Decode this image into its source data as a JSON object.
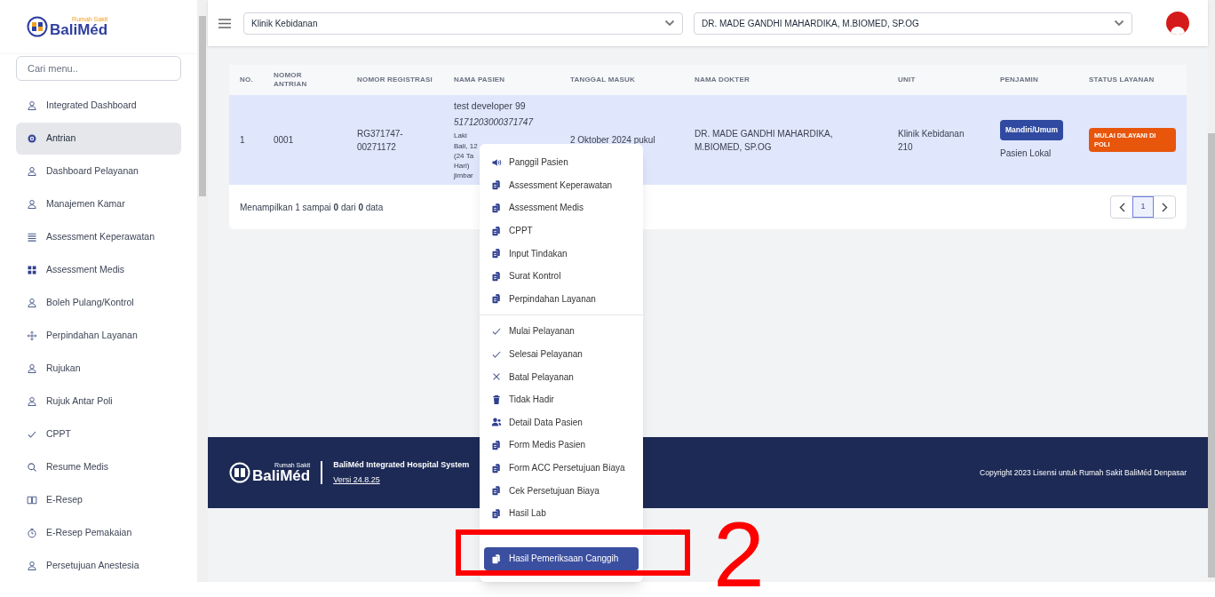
{
  "sidebar": {
    "logo": {
      "top": "Rumah Sakit",
      "name": "BaliMéd"
    },
    "search": {
      "placeholder": "Cari menu.."
    },
    "items": [
      {
        "label": "Integrated Dashboard",
        "kind": "user",
        "selected": false
      },
      {
        "label": "Antrian",
        "kind": "at",
        "selected": true
      },
      {
        "label": "Dashboard Pelayanan",
        "kind": "user",
        "selected": false
      },
      {
        "label": "Manajemen Kamar",
        "kind": "user",
        "selected": false
      },
      {
        "label": "Assessment Keperawatan",
        "kind": "list",
        "selected": false
      },
      {
        "label": "Assessment Medis",
        "kind": "grid",
        "selected": false
      },
      {
        "label": "Boleh Pulang/Kontrol",
        "kind": "user",
        "selected": false
      },
      {
        "label": "Perpindahan Layanan",
        "kind": "move",
        "selected": false
      },
      {
        "label": "Rujukan",
        "kind": "user",
        "selected": false
      },
      {
        "label": "Rujuk Antar Poli",
        "kind": "user",
        "selected": false
      },
      {
        "label": "CPPT",
        "kind": "check",
        "selected": false
      },
      {
        "label": "Resume Medis",
        "kind": "search",
        "selected": false
      },
      {
        "label": "E-Resep",
        "kind": "book",
        "selected": false
      },
      {
        "label": "E-Resep Pemakaian",
        "kind": "clock",
        "selected": false
      },
      {
        "label": "Persetujuan Anestesia",
        "kind": "user",
        "selected": false
      }
    ]
  },
  "header": {
    "clinic_select": "Klinik Kebidanan",
    "doctor_select": "DR. MADE GANDHI MAHARDIKA, M.BIOMED, SP.OG"
  },
  "table": {
    "columns": [
      "NO.",
      "NOMOR ANTRIAN",
      "NOMOR REGISTRASI",
      "NAMA PASIEN",
      "TANGGAL MASUK",
      "NAMA DOKTER",
      "UNIT",
      "PENJAMIN",
      "STATUS LAYANAN"
    ],
    "rows": [
      {
        "selected": true,
        "no": "1",
        "antrian": "0001",
        "registrasi": "RG371747-00271172",
        "nama": "test developer 99",
        "nik": "5171203000371747",
        "details": [
          "Laki",
          "Bali, 12",
          "(24 Ta",
          "Hari)",
          "jimbar"
        ],
        "tanggal": "2 Oktober 2024 pukul",
        "dokter": "DR. MADE GANDHI MAHARDIKA, M.BIOMED, SP.OG",
        "unit": "Klinik Kebidanan 210",
        "penjamin": "Mandiri/Umum",
        "penjamin_note": "Pasien Lokal",
        "status": "MULAI DILAYANI DI POLI"
      }
    ],
    "summary": "Menampilkan 1 sampai **0** dari **0** data",
    "pages": [
      {
        "label": "1",
        "selected": true
      }
    ]
  },
  "context_menu": [
    {
      "label": "Panggil Pasien",
      "kind": "speaker",
      "selected": false
    },
    {
      "label": "Assessment Keperawatan",
      "kind": "doc",
      "selected": false
    },
    {
      "label": "Assessment Medis",
      "kind": "doc",
      "selected": false
    },
    {
      "label": "CPPT",
      "kind": "doc",
      "selected": false
    },
    {
      "label": "Input Tindakan",
      "kind": "doc",
      "selected": false
    },
    {
      "label": "Surat Kontrol",
      "kind": "doc",
      "selected": false
    },
    {
      "label": "Perpindahan Layanan",
      "kind": "doc",
      "selected": false
    },
    {
      "kind": "separator"
    },
    {
      "label": "Mulai Pelayanan",
      "kind": "check",
      "selected": false
    },
    {
      "label": "Selesai Pelayanan",
      "kind": "check",
      "selected": false
    },
    {
      "label": "Batal Pelayanan",
      "kind": "x",
      "selected": false
    },
    {
      "label": "Tidak Hadir",
      "kind": "trash",
      "selected": false
    },
    {
      "label": "Detail Data Pasien",
      "kind": "users",
      "selected": false
    },
    {
      "label": "Form Medis Pasien",
      "kind": "doc",
      "selected": false
    },
    {
      "label": "Form ACC Persetujuan Biaya",
      "kind": "doc",
      "selected": false
    },
    {
      "label": "Cek Persetujuan Biaya",
      "kind": "doc",
      "selected": false
    },
    {
      "label": "Hasil Lab",
      "kind": "doc",
      "selected": false
    },
    {
      "kind": "hidden"
    },
    {
      "label": "Hasil Pemeriksaan Canggih",
      "kind": "doc",
      "selected": true
    }
  ],
  "footer": {
    "logo": {
      "top": "Rumah Sakit",
      "name": "BaliMéd"
    },
    "system": "BaliMéd Integrated Hospital System",
    "version": "Versi 24.8.25",
    "copyright": "Copyright 2023 Lisensi untuk Rumah Sakit BaliMéd Denpasar"
  },
  "annotation": {
    "label": "2"
  }
}
